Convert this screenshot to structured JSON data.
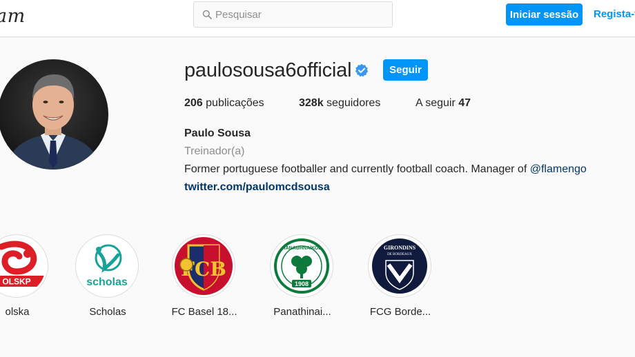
{
  "topbar": {
    "logo": "am",
    "search_placeholder": "Pesquisar",
    "login_label": "Iniciar sessão",
    "register_label": "Regista-t"
  },
  "profile": {
    "username": "paulosousa6official",
    "follow_label": "Seguir",
    "stats": {
      "posts_count": "206",
      "posts_label": "publicações",
      "followers_count": "328k",
      "followers_label": "seguidores",
      "following_label": "A seguir",
      "following_count": "47"
    },
    "full_name": "Paulo Sousa",
    "category": "Treinador(a)",
    "bio_text": "Former portuguese footballer and currently football coach. Manager of ",
    "bio_mention": "@flamengo",
    "website": "twitter.com/paulomcdsousa"
  },
  "highlights": [
    {
      "label": "olska",
      "icon": "polska-crest-icon"
    },
    {
      "label": "Scholas",
      "icon": "scholas-logo-icon"
    },
    {
      "label": "FC Basel 18...",
      "icon": "fc-basel-crest-icon"
    },
    {
      "label": "Panathinai...",
      "icon": "panathinaikos-crest-icon"
    },
    {
      "label": "FCG Borde...",
      "icon": "girondins-bordeaux-crest-icon"
    }
  ],
  "badge_text": {
    "polska": "OLSKP",
    "scholas": "scholas",
    "panathinaikos_top": "ΠΑΝΑΘΗΝΑΪΚΟΣ",
    "panathinaikos_year": "1908",
    "bordeaux_top": "GIRONDINS",
    "bordeaux_sub": "DE BORDEAUX"
  },
  "colors": {
    "accent": "#0095f6",
    "link": "#00376b",
    "muted": "#8e8e8e",
    "border": "#dbdbdb"
  }
}
